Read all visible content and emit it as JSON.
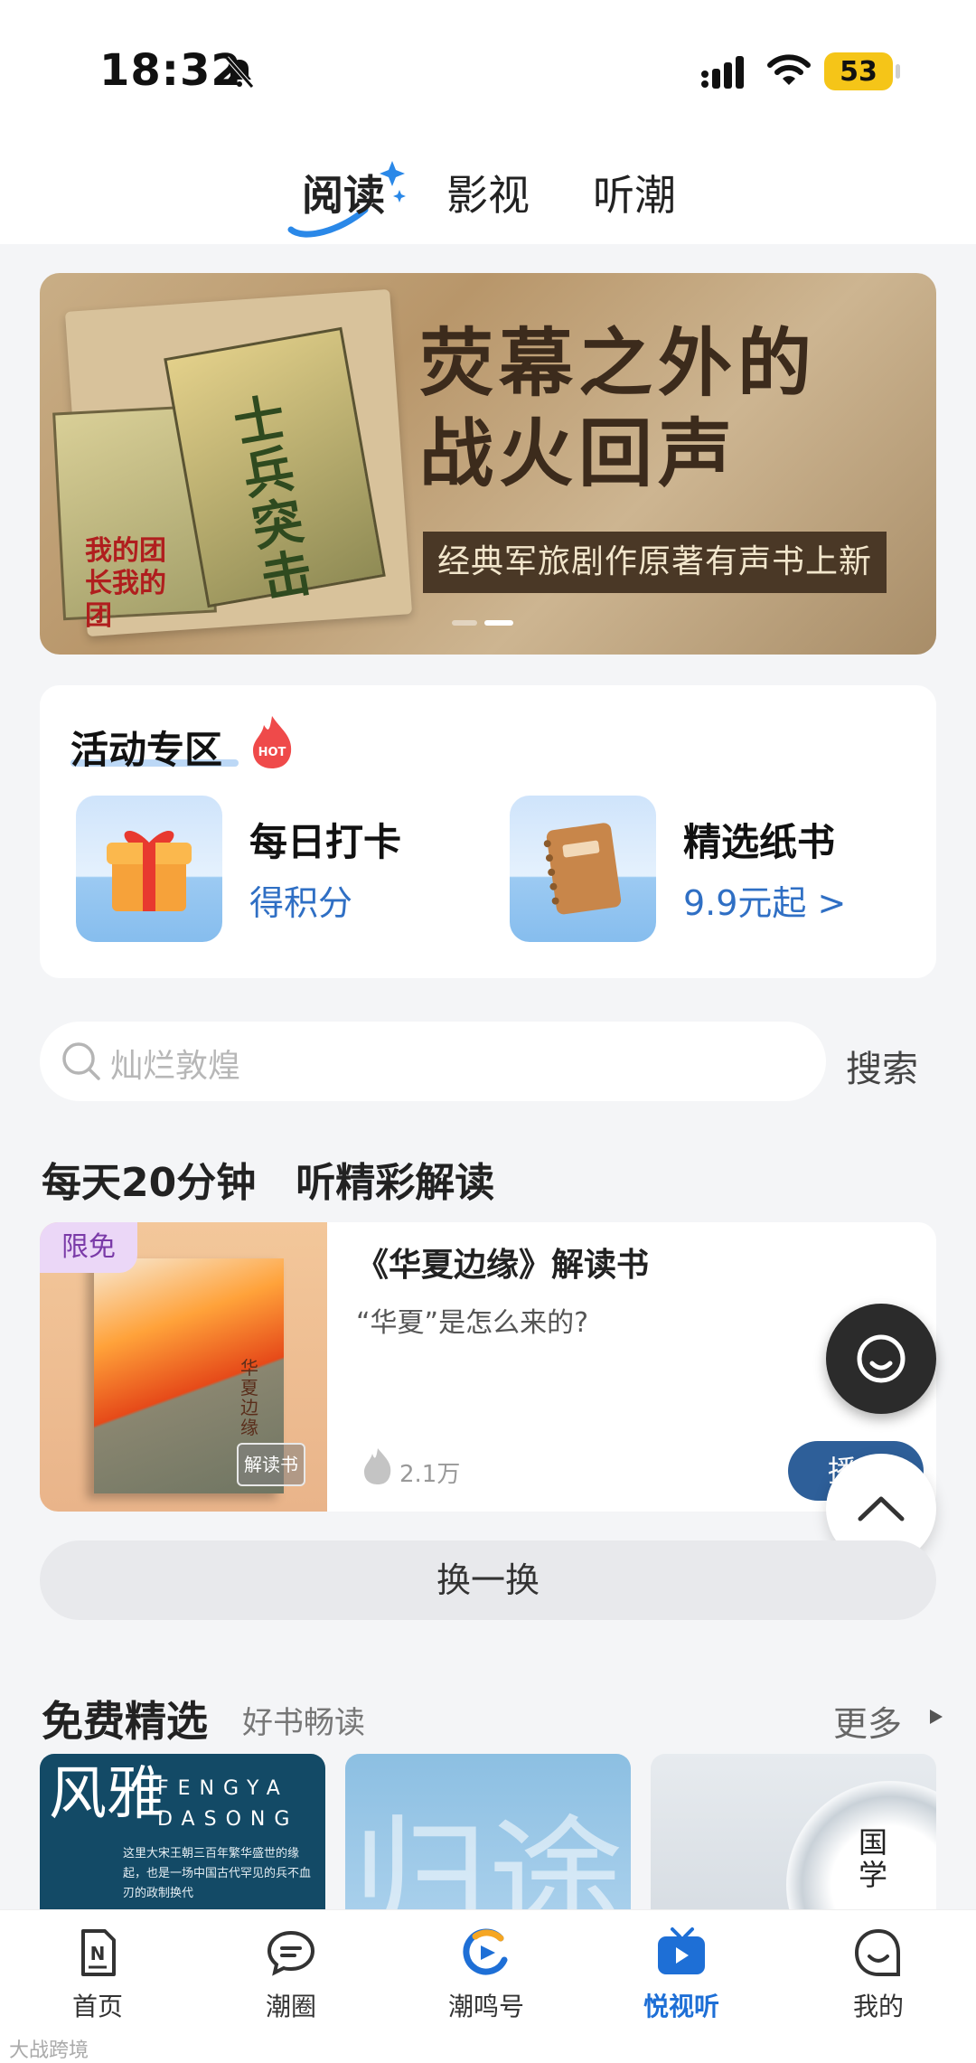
{
  "status_bar": {
    "time": "18:32",
    "battery": "53"
  },
  "top_tabs": [
    {
      "label": "阅读",
      "active": true
    },
    {
      "label": "影视",
      "active": false
    },
    {
      "label": "听潮",
      "active": false
    }
  ],
  "banner": {
    "title_line1": "荧幕之外的",
    "title_line2": "战火回声",
    "subtitle": "经典军旅剧作原著有声书上新",
    "book1_title": "我的团长我的团",
    "book2_title": "士兵突击",
    "slides_total": 2,
    "slide_active_index": 1
  },
  "activity": {
    "title": "活动专区",
    "hot_badge": "HOT",
    "items": [
      {
        "name": "每日打卡",
        "sub": "得积分",
        "icon": "gift-icon"
      },
      {
        "name": "精选纸书",
        "sub": "9.9元起 >",
        "icon": "notebook-icon"
      }
    ]
  },
  "search": {
    "placeholder": "灿烂敦煌",
    "button": "搜索"
  },
  "section_daily": {
    "title": "每天20分钟　听精彩解读",
    "card": {
      "badge": "限免",
      "cover_badge": "解读书",
      "cover_text": "华夏边缘",
      "title": "《华夏边缘》解读书",
      "desc": "“华夏”是怎么来的?",
      "count": "2.1万",
      "play_label": "播"
    },
    "swap_label": "换一换"
  },
  "section_free": {
    "title": "免费精选",
    "subtitle": "好书畅读",
    "more": "更多",
    "tiles": [
      {
        "big": "风雅",
        "en": "FENGYA DASONG",
        "text": "这里大宋王朝三百年繁华盛世的缘起，也是一场中国古代罕见的兵不血刃的政制换代"
      },
      {
        "big": "归途"
      },
      {
        "vertical": "国学"
      }
    ]
  },
  "bottom_nav": [
    {
      "label": "首页",
      "icon": "home-doc-icon",
      "active": false
    },
    {
      "label": "潮圈",
      "icon": "chat-bubble-icon",
      "active": false
    },
    {
      "label": "潮鸣号",
      "icon": "chaoming-logo-icon",
      "active": false
    },
    {
      "label": "悦视听",
      "icon": "tv-play-icon",
      "active": true
    },
    {
      "label": "我的",
      "icon": "profile-face-icon",
      "active": false
    }
  ],
  "watermark": "大战跨境"
}
